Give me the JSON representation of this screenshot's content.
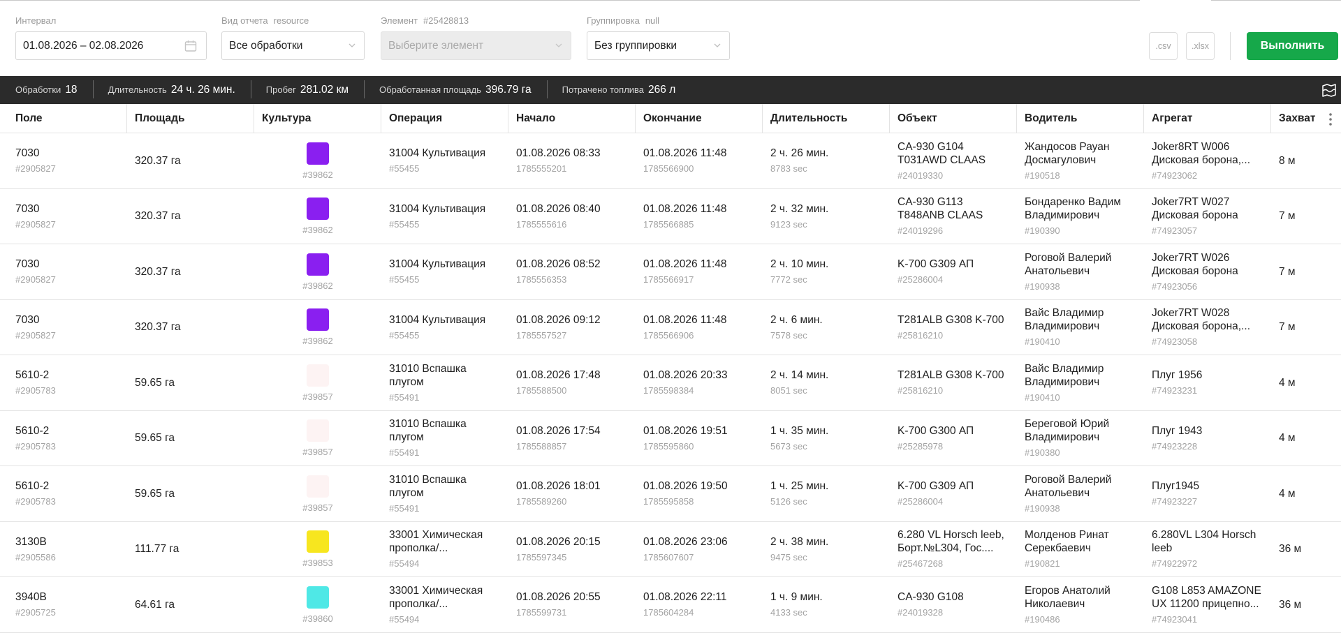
{
  "filters": {
    "interval": {
      "label": "Интервал",
      "value": "01.08.2026 – 02.08.2026"
    },
    "report_type": {
      "label": "Вид отчета",
      "hint": "resource",
      "value": "Все обработки"
    },
    "element": {
      "label": "Элемент",
      "hint": "#25428813",
      "placeholder": "Выберите элемент"
    },
    "grouping": {
      "label": "Группировка",
      "hint": "null",
      "value": "Без группировки"
    },
    "export_csv": ".csv",
    "export_xlsx": ".xlsx",
    "run_label": "Выполнить"
  },
  "summary": [
    {
      "label": "Обработки",
      "value": "18"
    },
    {
      "label": "Длительность",
      "value": "24 ч. 26 мин."
    },
    {
      "label": "Пробег",
      "value": "281.02 км"
    },
    {
      "label": "Обработанная площадь",
      "value": "396.79 га"
    },
    {
      "label": "Потрачено топлива",
      "value": "266 л"
    }
  ],
  "columns": [
    "Поле",
    "Площадь",
    "Культура",
    "Операция",
    "Начало",
    "Окончание",
    "Длительность",
    "Объект",
    "Водитель",
    "Агрегат",
    "Захват"
  ],
  "rows": [
    {
      "field": "7030",
      "field_id": "#2905827",
      "area": "320.37 га",
      "culture_color": "#8a1ff0",
      "culture_id": "#39862",
      "operation": "31004 Культивация",
      "operation_id": "#55455",
      "start": "01.08.2026 08:33",
      "start_ts": "1785555201",
      "end": "01.08.2026 11:48",
      "end_ts": "1785566900",
      "duration": "2 ч. 26 мин.",
      "duration_sec": "8783 sec",
      "object": "CA-930 G104 T031AWD CLAAS",
      "object_id": "#24019330",
      "driver": "Жандосов Рауан Досмагулович",
      "driver_id": "#190518",
      "aggregate": "Joker8RT W006 Дисковая борона,...",
      "aggregate_id": "#74923062",
      "width": "8 м"
    },
    {
      "field": "7030",
      "field_id": "#2905827",
      "area": "320.37 га",
      "culture_color": "#8a1ff0",
      "culture_id": "#39862",
      "operation": "31004 Культивация",
      "operation_id": "#55455",
      "start": "01.08.2026 08:40",
      "start_ts": "1785555616",
      "end": "01.08.2026 11:48",
      "end_ts": "1785566885",
      "duration": "2 ч. 32 мин.",
      "duration_sec": "9123 sec",
      "object": "CA-930 G113 T848ANB CLAAS",
      "object_id": "#24019296",
      "driver": "Бондаренко Вадим Владимирович",
      "driver_id": "#190390",
      "aggregate": "Joker7RT W027 Дисковая борона",
      "aggregate_id": "#74923057",
      "width": "7 м"
    },
    {
      "field": "7030",
      "field_id": "#2905827",
      "area": "320.37 га",
      "culture_color": "#8a1ff0",
      "culture_id": "#39862",
      "operation": "31004 Культивация",
      "operation_id": "#55455",
      "start": "01.08.2026 08:52",
      "start_ts": "1785556353",
      "end": "01.08.2026 11:48",
      "end_ts": "1785566917",
      "duration": "2 ч. 10 мин.",
      "duration_sec": "7772 sec",
      "object": "K-700 G309 АП",
      "object_id": "#25286004",
      "driver": "Роговой Валерий Анатольевич",
      "driver_id": "#190938",
      "aggregate": "Joker7RT W026 Дисковая борона",
      "aggregate_id": "#74923056",
      "width": "7 м"
    },
    {
      "field": "7030",
      "field_id": "#2905827",
      "area": "320.37 га",
      "culture_color": "#8a1ff0",
      "culture_id": "#39862",
      "operation": "31004 Культивация",
      "operation_id": "#55455",
      "start": "01.08.2026 09:12",
      "start_ts": "1785557527",
      "end": "01.08.2026 11:48",
      "end_ts": "1785566906",
      "duration": "2 ч. 6 мин.",
      "duration_sec": "7578 sec",
      "object": "T281ALB G308 K-700",
      "object_id": "#25816210",
      "driver": "Вайс Владимир Владимирович",
      "driver_id": "#190410",
      "aggregate": "Joker7RT W028 Дисковая борона,...",
      "aggregate_id": "#74923058",
      "width": "7 м"
    },
    {
      "field": "5610-2",
      "field_id": "#2905783",
      "area": "59.65 га",
      "culture_color": "#fdf3f3",
      "culture_id": "#39857",
      "operation": "31010 Вспашка плугом",
      "operation_id": "#55491",
      "start": "01.08.2026 17:48",
      "start_ts": "1785588500",
      "end": "01.08.2026 20:33",
      "end_ts": "1785598384",
      "duration": "2 ч. 14 мин.",
      "duration_sec": "8051 sec",
      "object": "T281ALB G308 K-700",
      "object_id": "#25816210",
      "driver": "Вайс Владимир Владимирович",
      "driver_id": "#190410",
      "aggregate": "Плуг 1956",
      "aggregate_id": "#74923231",
      "width": "4 м"
    },
    {
      "field": "5610-2",
      "field_id": "#2905783",
      "area": "59.65 га",
      "culture_color": "#fdf3f3",
      "culture_id": "#39857",
      "operation": "31010 Вспашка плугом",
      "operation_id": "#55491",
      "start": "01.08.2026 17:54",
      "start_ts": "1785588857",
      "end": "01.08.2026 19:51",
      "end_ts": "1785595860",
      "duration": "1 ч. 35 мин.",
      "duration_sec": "5673 sec",
      "object": "K-700 G300 АП",
      "object_id": "#25285978",
      "driver": "Береговой Юрий Владимирович",
      "driver_id": "#190380",
      "aggregate": "Плуг 1943",
      "aggregate_id": "#74923228",
      "width": "4 м"
    },
    {
      "field": "5610-2",
      "field_id": "#2905783",
      "area": "59.65 га",
      "culture_color": "#fdf3f3",
      "culture_id": "#39857",
      "operation": "31010 Вспашка плугом",
      "operation_id": "#55491",
      "start": "01.08.2026 18:01",
      "start_ts": "1785589260",
      "end": "01.08.2026 19:50",
      "end_ts": "1785595858",
      "duration": "1 ч. 25 мин.",
      "duration_sec": "5126 sec",
      "object": "K-700 G309 АП",
      "object_id": "#25286004",
      "driver": "Роговой Валерий Анатольевич",
      "driver_id": "#190938",
      "aggregate": "Плуг1945",
      "aggregate_id": "#74923227",
      "width": "4 м"
    },
    {
      "field": "3130B",
      "field_id": "#2905586",
      "area": "111.77 га",
      "culture_color": "#f7e61f",
      "culture_id": "#39853",
      "operation": "33001 Химическая прополка/...",
      "operation_id": "#55494",
      "start": "01.08.2026 20:15",
      "start_ts": "1785597345",
      "end": "01.08.2026 23:06",
      "end_ts": "1785607607",
      "duration": "2 ч. 38 мин.",
      "duration_sec": "9475 sec",
      "object": "6.280 VL Horsch leeb, Борт.№L304, Гос....",
      "object_id": "#25467268",
      "driver": "Молденов Ринат Серекбаевич",
      "driver_id": "#190821",
      "aggregate": "6.280VL L304 Horsch leeb",
      "aggregate_id": "#74922972",
      "width": "36 м"
    },
    {
      "field": "3940B",
      "field_id": "#2905725",
      "area": "64.61 га",
      "culture_color": "#4fe8e6",
      "culture_id": "#39860",
      "operation": "33001 Химическая прополка/...",
      "operation_id": "#55494",
      "start": "01.08.2026 20:55",
      "start_ts": "1785599731",
      "end": "01.08.2026 22:11",
      "end_ts": "1785604284",
      "duration": "1 ч. 9 мин.",
      "duration_sec": "4133 sec",
      "object": "CA-930 G108",
      "object_id": "#24019328",
      "driver": "Егоров Анатолий Николаевич",
      "driver_id": "#190486",
      "aggregate": "G108 L853 AMAZONE UX 11200 прицепно...",
      "aggregate_id": "#74923041",
      "width": "36 м"
    }
  ]
}
